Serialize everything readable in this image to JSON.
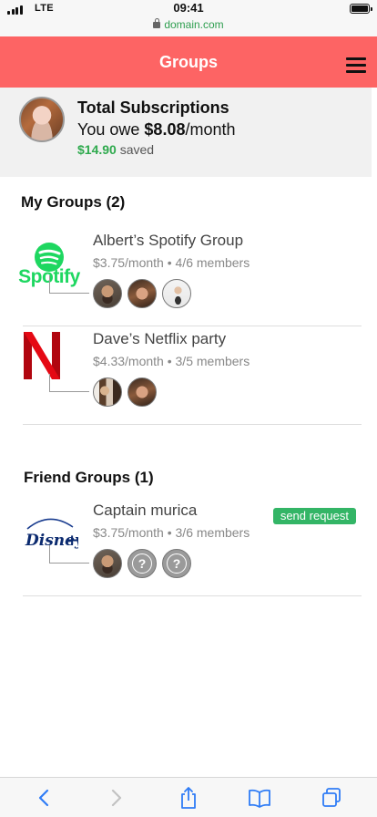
{
  "status_bar": {
    "carrier": "LTE",
    "time": "09:41",
    "url": "domain.com",
    "battery_level": 1.0
  },
  "header": {
    "title": "Groups",
    "menu_icon": "hamburger-menu-icon"
  },
  "summary": {
    "title": "Total Subscriptions",
    "owe_prefix": "You owe",
    "owe_amount": "$8.08",
    "owe_suffix": "/month",
    "saved_amount": "$14.90",
    "saved_label": "saved"
  },
  "my_groups": {
    "title": "My Groups (2)",
    "items": [
      {
        "name": "Albert’s Spotify Group",
        "meta": "$3.75/month • 4/6 members",
        "logo": "spotify-logo",
        "logo_text": "Spotify",
        "brand_color": "#1ed760"
      },
      {
        "name": "Dave’s Netflix party",
        "meta": "$4.33/month • 3/5 members",
        "logo": "netflix-logo",
        "brand_color": "#e50914"
      }
    ]
  },
  "friend_groups": {
    "title": "Friend Groups (1)",
    "items": [
      {
        "name": "Captain murica",
        "meta": "$3.75/month • 3/6 members",
        "logo": "disney-plus-logo",
        "logo_text": "Disney+",
        "action_label": "send request",
        "placeholder_symbol": "?"
      }
    ]
  },
  "colors": {
    "header_bg": "#fd6464",
    "saved_green": "#2faa4e",
    "request_green": "#33b566",
    "toolbar_blue": "#2f7cf6"
  },
  "toolbar": {
    "icons": [
      "back-icon",
      "forward-icon",
      "share-icon",
      "bookmarks-icon",
      "tabs-icon"
    ]
  }
}
